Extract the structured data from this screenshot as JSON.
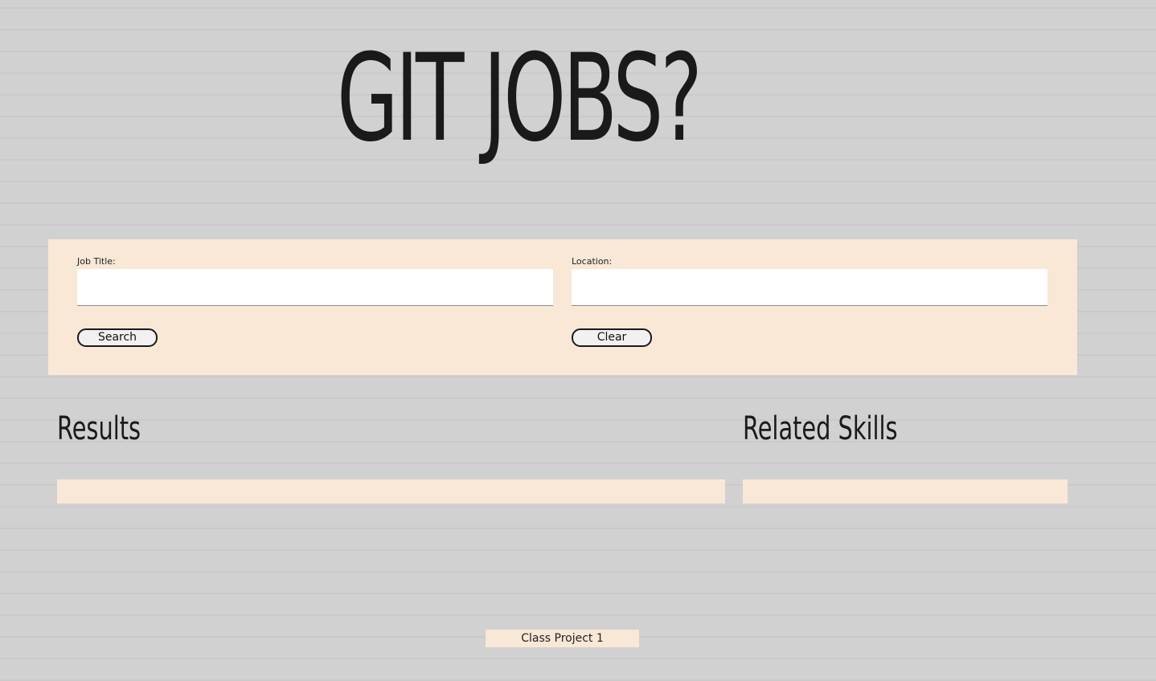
{
  "title": "GIT JOBS?",
  "search_form": {
    "job_title_label": "Job Title:",
    "job_title_value": "",
    "location_label": "Location:",
    "location_value": "",
    "search_button": "Search",
    "clear_button": "Clear"
  },
  "results": {
    "heading": "Results"
  },
  "related_skills": {
    "heading": "Related Skills"
  },
  "footer": {
    "text": "Class Project 1"
  },
  "colors": {
    "panel_bg": "#f8e8d5",
    "background": "#d1d1d1",
    "text": "#1a1a1a"
  }
}
